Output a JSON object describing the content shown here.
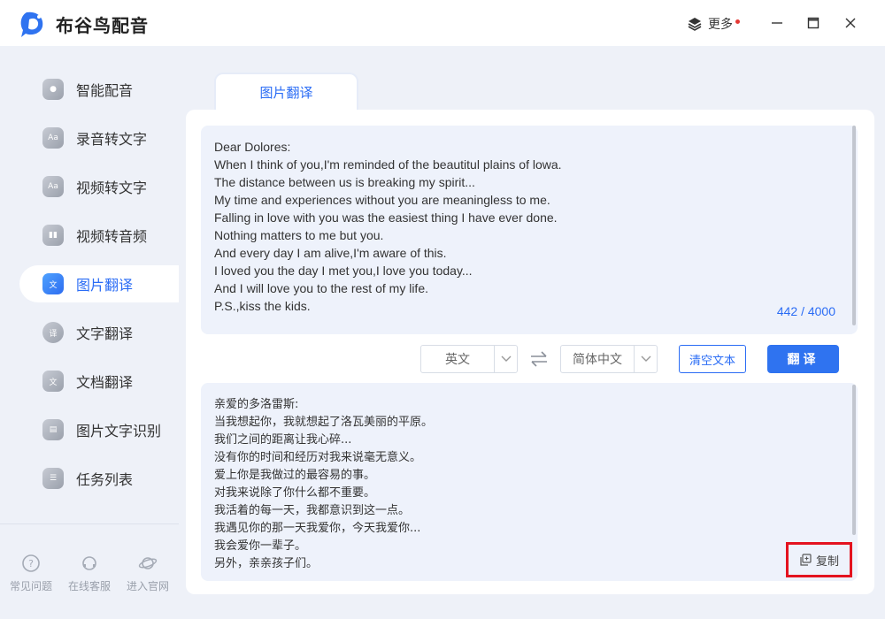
{
  "app": {
    "title": "布谷鸟配音"
  },
  "titlebar": {
    "more_label": "更多"
  },
  "sidebar": {
    "items": [
      {
        "label": "智能配音",
        "icon": "mic-icon",
        "active": false
      },
      {
        "label": "录音转文字",
        "icon": "recording-to-text-icon",
        "active": false
      },
      {
        "label": "视频转文字",
        "icon": "video-to-text-icon",
        "active": false
      },
      {
        "label": "视频转音频",
        "icon": "video-to-audio-icon",
        "active": false
      },
      {
        "label": "图片翻译",
        "icon": "image-translate-icon",
        "active": true
      },
      {
        "label": "文字翻译",
        "icon": "text-translate-icon",
        "active": false
      },
      {
        "label": "文档翻译",
        "icon": "document-translate-icon",
        "active": false
      },
      {
        "label": "图片文字识别",
        "icon": "image-ocr-icon",
        "active": false
      },
      {
        "label": "任务列表",
        "icon": "task-list-icon",
        "active": false
      }
    ],
    "bottom_links": [
      {
        "label": "常见问题",
        "icon": "question-icon"
      },
      {
        "label": "在线客服",
        "icon": "headset-icon"
      },
      {
        "label": "进入官网",
        "icon": "planet-icon"
      }
    ]
  },
  "main": {
    "tab_label": "图片翻译",
    "source_lines": [
      "Dear Dolores:",
      "When I think of you,I'm reminded of the beautitul plains of lowa.",
      "The distance between us is breaking my spirit...",
      "My time and experiences without you are meaningless to me.",
      "Falling in love with you was the easiest thing I have ever done.",
      "Nothing matters to me but you.",
      "And every day I am alive,I'm aware of this.",
      "I loved you the day I met you,I love you today...",
      "And I will love you to the rest of my life.",
      "P.S.,kiss the kids."
    ],
    "char_count": "442 / 4000",
    "source_language": "英文",
    "target_language": "简体中文",
    "clear_label": "清空文本",
    "translate_label": "翻译",
    "result_lines": [
      "亲爱的多洛雷斯:",
      "当我想起你，我就想起了洛瓦美丽的平原。",
      "我们之间的距离让我心碎...",
      "没有你的时间和经历对我来说毫无意义。",
      "爱上你是我做过的最容易的事。",
      "对我来说除了你什么都不重要。",
      "我活着的每一天，我都意识到这一点。",
      "我遇见你的那一天我爱你，今天我爱你...",
      "我会爱你一辈子。",
      "另外，亲亲孩子们。"
    ],
    "copy_label": "复制"
  },
  "colors": {
    "accent": "#2a6cf5",
    "highlight": "#e4131f",
    "sidebar_bg": "#eef1f8"
  }
}
